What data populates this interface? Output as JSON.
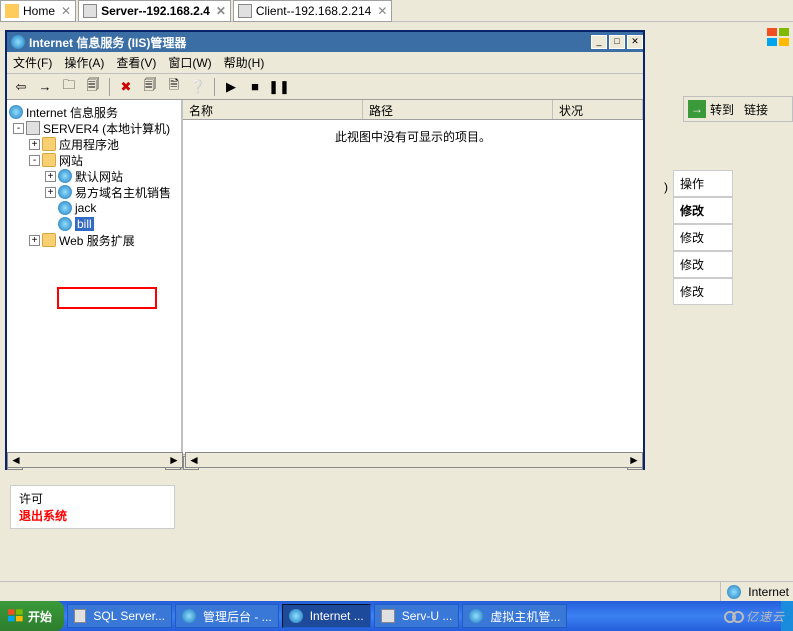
{
  "top_tabs": [
    {
      "label": "Home"
    },
    {
      "label": "Server--192.168.2.4"
    },
    {
      "label": "Client--192.168.2.214"
    }
  ],
  "iis": {
    "title": "Internet 信息服务 (IIS)管理器",
    "menu": {
      "file": "文件(F)",
      "op": "操作(A)",
      "view": "查看(V)",
      "window": "窗口(W)",
      "help": "帮助(H)"
    },
    "toolbar": {
      "back": "⇦",
      "fwd": "→",
      "up": "🗀",
      "props": "🗐",
      "refresh": "✖",
      "export": "🗐",
      "edit": "🗎",
      "help": "❔",
      "play": "▶",
      "stop": "■",
      "pause": "❚❚"
    },
    "tree": {
      "root": "Internet 信息服务",
      "server": "SERVER4 (本地计算机)",
      "app_pool": "应用程序池",
      "sites": "网站",
      "site1": "默认网站",
      "site2": "易方域名主机销售",
      "site3": "jack",
      "site4": "bill",
      "webext": "Web 服务扩展"
    },
    "list": {
      "col_name": "名称",
      "col_path": "路径",
      "col_status": "状况",
      "empty_msg": "此视图中没有可显示的项目。"
    }
  },
  "perm": {
    "allow": "许可",
    "exit": "退出系统"
  },
  "actions": {
    "goto": "转到",
    "links": "链接",
    "operate": "操作",
    "modify_bold": "修改",
    "modify": "修改",
    "small_num": ")"
  },
  "status": {
    "internet": "Internet"
  },
  "taskbar": {
    "start": "开始",
    "items": [
      "SQL Server...",
      "管理后台 - ...",
      "Internet ...",
      "Serv-U ...",
      "虚拟主机管..."
    ]
  },
  "watermark": "亿速云"
}
